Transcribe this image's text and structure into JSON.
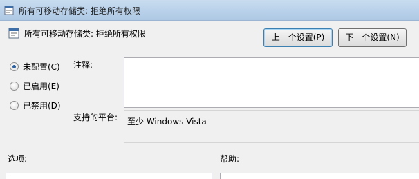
{
  "window": {
    "title": "所有可移动存储类: 拒绝所有权限",
    "icon": "policy-editor-icon"
  },
  "header": {
    "setting_title": "所有可移动存储类: 拒绝所有权限",
    "setting_icon": "policy-setting-icon",
    "prev_button": "上一个设置(P)",
    "next_button": "下一个设置(N)"
  },
  "state": {
    "options": [
      {
        "label": "未配置(C)",
        "checked": true
      },
      {
        "label": "已启用(E)",
        "checked": false
      },
      {
        "label": "已禁用(D)",
        "checked": false
      }
    ]
  },
  "comment": {
    "label": "注释:",
    "value": ""
  },
  "platform": {
    "label": "支持的平台:",
    "value": "至少 Windows Vista"
  },
  "sections": {
    "options_label": "选项:",
    "help_label": "帮助:"
  },
  "colors": {
    "titlebar": "#b9d1ea",
    "window_bg": "#f0f0f0",
    "focus_border": "#3c7fb1"
  }
}
